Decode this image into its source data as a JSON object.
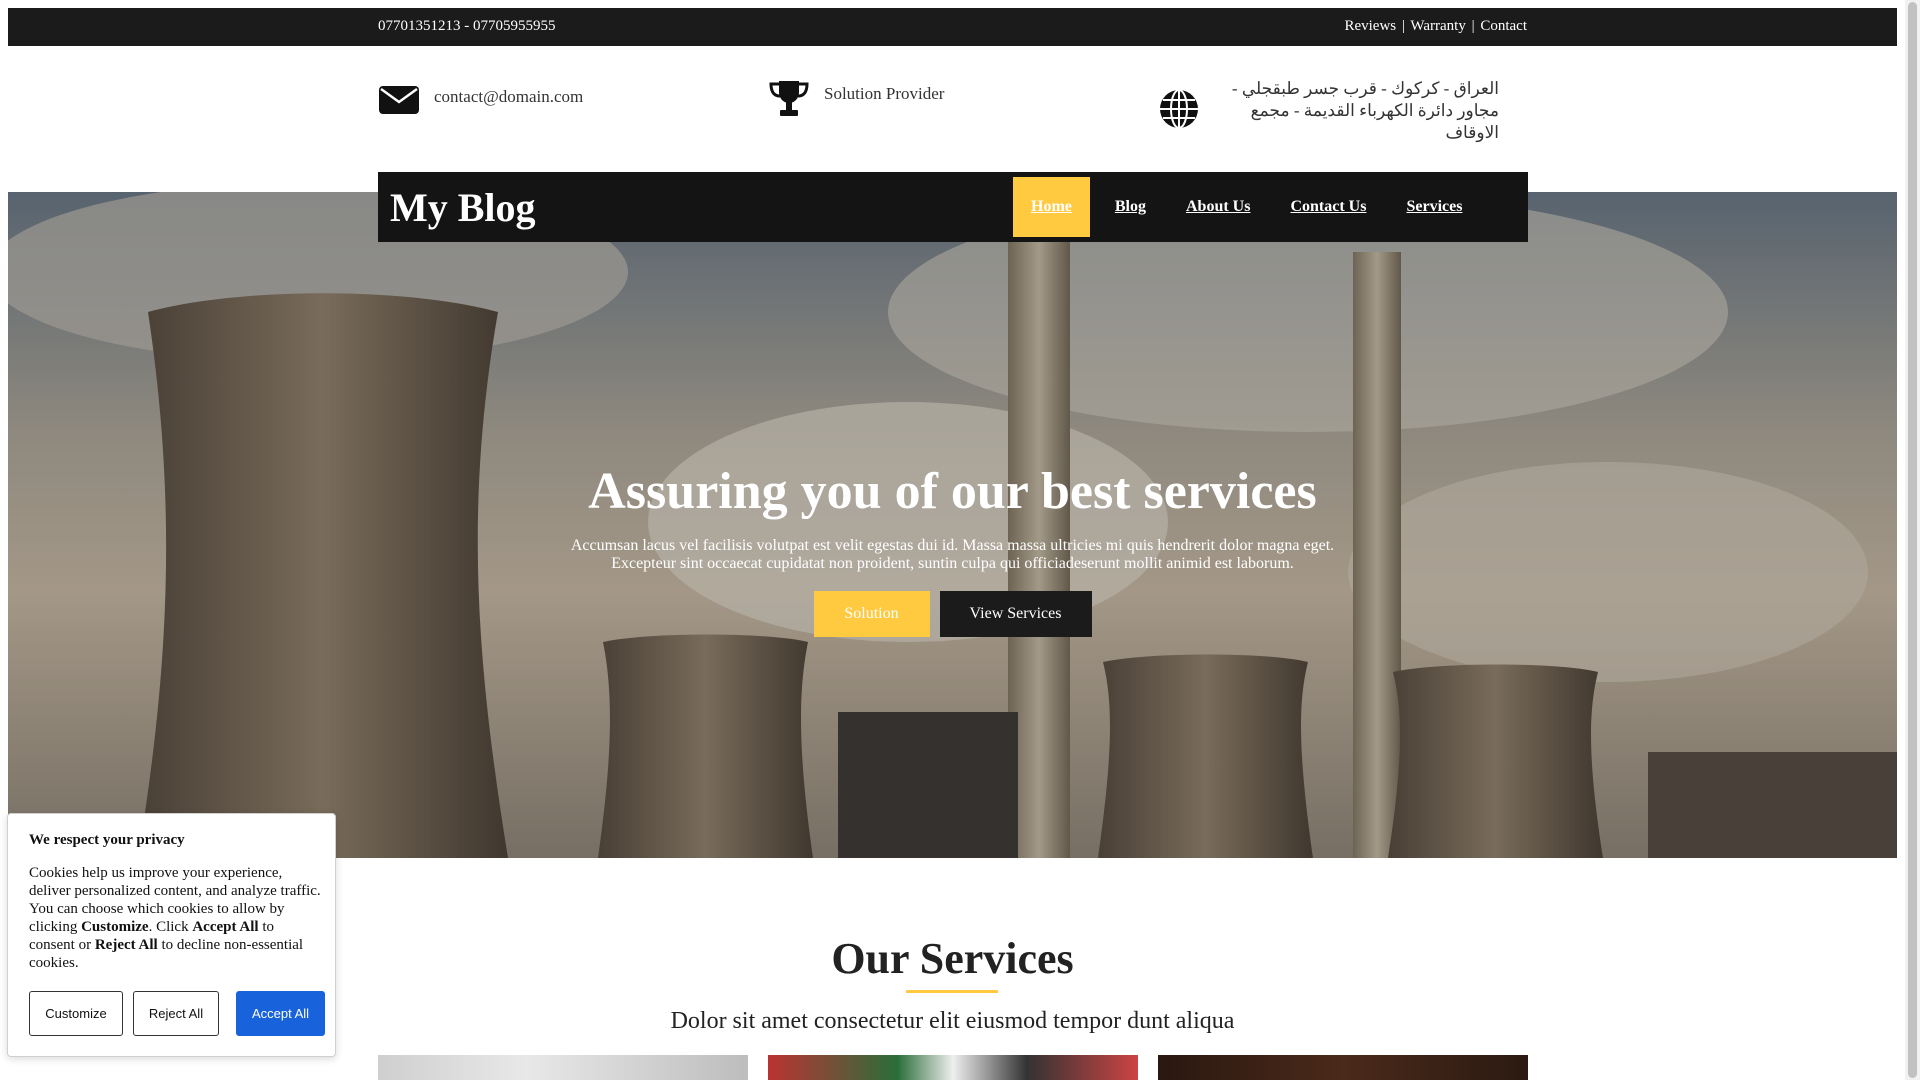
{
  "topbar": {
    "phones": "07701351213 - 07705955955",
    "links": [
      "Reviews",
      "Warranty",
      "Contact"
    ],
    "separator": "|"
  },
  "info": {
    "email": "contact@domain.com",
    "tagline": "Solution Provider",
    "address": "العراق - كركوك - قرب جسر طبقجلي - مجاور دائرة الكهرباء القديمة - مجمع الاوقاف",
    "icons": [
      "envelope-icon",
      "trophy-icon",
      "globe-icon"
    ]
  },
  "navbar": {
    "brand": "My Blog",
    "items": [
      {
        "label": "Home",
        "active": true
      },
      {
        "label": "Blog",
        "active": false
      },
      {
        "label": "About Us",
        "active": false
      },
      {
        "label": "Contact Us",
        "active": false
      },
      {
        "label": "Services",
        "active": false
      }
    ]
  },
  "hero": {
    "title": "Assuring you of our best services",
    "desc_line1": "Accumsan lacus vel facilisis volutpat est velit egestas dui id. Massa massa ultricies mi quis hendrerit dolor magna eget.",
    "desc_line2": "Excepteur sint occaecat cupidatat non proident, suntin culpa qui officiadeserunt mollit animid est laborum.",
    "btn_primary": "Solution",
    "btn_secondary": "View Services"
  },
  "services": {
    "title": "Our Services",
    "subtitle": "Dolor sit amet consectetur elit eiusmod tempor dunt aliqua"
  },
  "cookie": {
    "title": "We respect your privacy",
    "text_html_parts": {
      "p1": "Cookies help us improve your experience, deliver personalized content, and analyze traffic. You can choose which cookies to allow by clicking ",
      "b1": "Customize",
      "p2": ". Click ",
      "b2": "Accept All",
      "p3": " to consent or ",
      "b3": "Reject All",
      "p4": " to decline non-essential cookies."
    },
    "btn_customize": "Customize",
    "btn_reject": "Reject All",
    "btn_accept": "Accept All"
  },
  "colors": {
    "accent": "#ffc940",
    "dark": "#1b1b1b",
    "cookie_accept": "#1863dc"
  }
}
